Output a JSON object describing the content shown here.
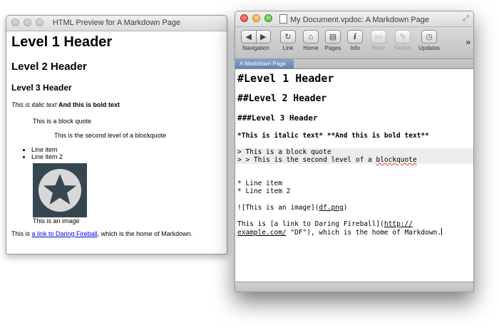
{
  "preview_window": {
    "title": "HTML Preview for A Markdown Page",
    "h1": "Level 1 Header",
    "h2": "Level 2 Header",
    "h3": "Level 3 Header",
    "italic_text": "This is italic text",
    "bold_text": "And this is bold text",
    "blockquote_1": "This is a block quote",
    "blockquote_2": "This is the second level of a blockquote",
    "list_items": [
      "Line item",
      "Line item 2"
    ],
    "image_caption": "This is an image",
    "link_sentence_before": "This is ",
    "link_text": "a link to Daring Fireball",
    "link_sentence_after": ", which is the home of Markdown."
  },
  "editor_window": {
    "title": "My Document.vpdoc: A Markdown Page",
    "toolbar": [
      {
        "label": "Navigation",
        "icon": "back-forward-arrows-icon",
        "enabled": true
      },
      {
        "label": "Link",
        "icon": "link-arrow-icon",
        "enabled": true
      },
      {
        "label": "Home",
        "icon": "home-icon",
        "enabled": true
      },
      {
        "label": "Pages",
        "icon": "pages-icon",
        "enabled": true
      },
      {
        "label": "Info",
        "icon": "info-icon",
        "enabled": true
      },
      {
        "label": "Ruler",
        "icon": "ruler-icon",
        "enabled": false
      },
      {
        "label": "Sketch",
        "icon": "sketch-brush-icon",
        "enabled": false
      },
      {
        "label": "Updates",
        "icon": "clock-icon",
        "enabled": true
      }
    ],
    "tab_label": "A Markdown Page",
    "lines": {
      "h1": "#Level 1 Header",
      "h2": "##Level 2 Header",
      "h3": "###Level 3 Header",
      "emphasis": "*This is italic text* **And this is bold text**",
      "quote1": "> This is a block quote",
      "quote2_before": "> > This is the second level of a ",
      "quote2_misspelled": "blockquote",
      "list1": "* Line item",
      "list2": "* Line item 2",
      "image_before": "![This is an image](",
      "image_file": "df.png",
      "image_after": ")",
      "link_line1_before": "This is [a link to Daring Fireball](",
      "link_url_part1": "http://",
      "link_url_part2": "example.com/",
      "link_line2_after": " \"DF\"), which is the home of Markdown."
    }
  }
}
